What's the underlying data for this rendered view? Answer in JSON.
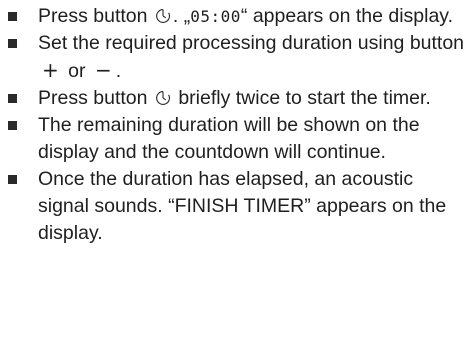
{
  "instructions": [
    {
      "before_icon": "Press button ",
      "icon": "timer-icon",
      "after_icon": ". ",
      "display_open_quote": "„",
      "display_value": "05:00",
      "display_close_quote": "“",
      "tail": " appears on the display."
    },
    {
      "text": "Set the required processing duration using button ",
      "plus": "+",
      "middle": " or ",
      "minus": "−",
      "end": "."
    },
    {
      "before_icon": "Press button ",
      "icon": "timer-icon",
      "after_icon": " briefly twice to start the timer."
    },
    {
      "text": "The remaining duration will be shown on the display and the countdown will continue."
    },
    {
      "text": "Once the duration has elapsed, an acoustic signal sounds. “FINISH TIMER” appears on the display."
    }
  ]
}
